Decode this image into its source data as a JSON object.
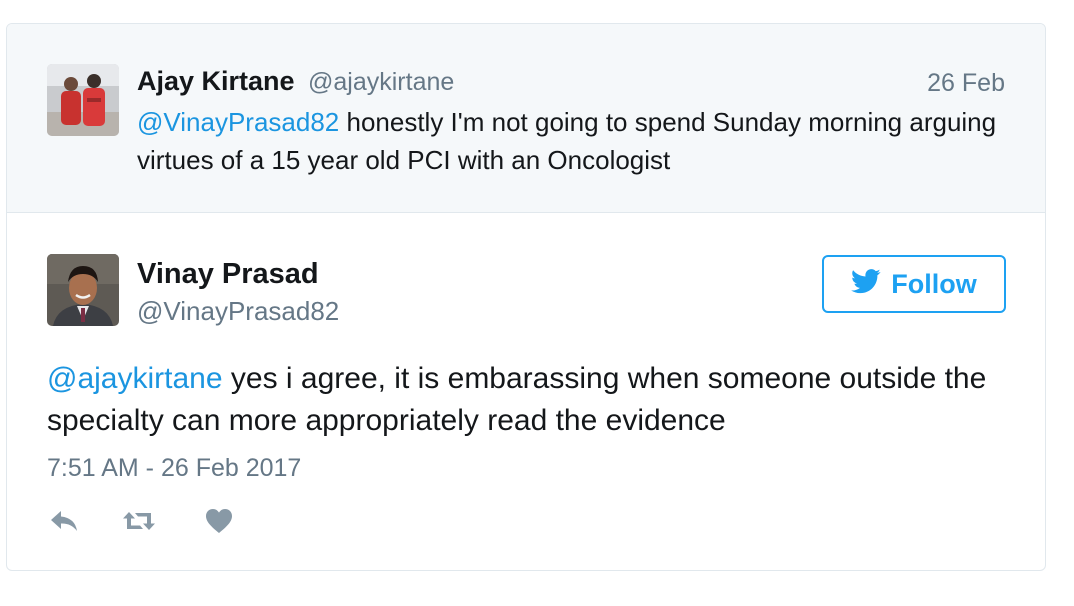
{
  "parent_tweet": {
    "author_name": "Ajay Kirtane",
    "author_handle": "@ajaykirtane",
    "date": "26 Feb",
    "mention": "@VinayPrasad82",
    "text": " honestly I'm not going to spend Sunday morning arguing virtues of a 15 year old PCI with an Oncologist"
  },
  "main_tweet": {
    "author_name": "Vinay Prasad",
    "author_handle": "@VinayPrasad82",
    "follow_label": "Follow",
    "mention": "@ajaykirtane",
    "text": " yes i agree, it is embarassing when someone outside the specialty can more appropriately read the evidence",
    "timestamp": "7:51 AM - 26 Feb 2017"
  },
  "icons": {
    "follow": "twitter-bird-icon",
    "reply": "reply-icon",
    "retweet": "retweet-icon",
    "like": "heart-icon"
  },
  "colors": {
    "link": "#1b95e0",
    "twitter_blue": "#1da1f2",
    "muted_text": "#657786",
    "action_icon": "#8899a6",
    "parent_background": "#f5f8fa"
  }
}
